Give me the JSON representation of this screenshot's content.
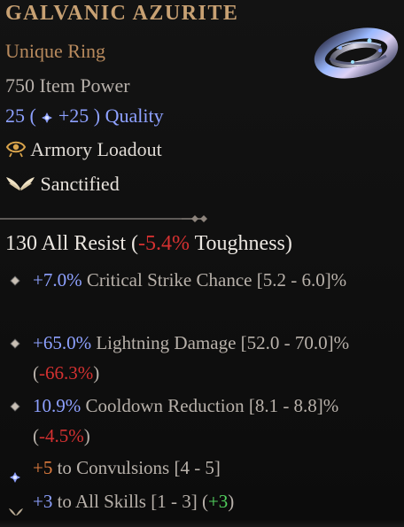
{
  "header": {
    "item_name": "GALVANIC AZURITE",
    "item_type": "Unique Ring",
    "item_power": "750 Item Power",
    "quality_prefix": "25 (",
    "quality_value": "+25",
    "quality_suffix": ") Quality",
    "armory_loadout": "Armory Loadout",
    "sanctified": "Sanctified"
  },
  "stats": {
    "resist_main": "130 All Resist (",
    "resist_toughness": "-5.4%",
    "resist_suffix": " Toughness)",
    "affixes": [
      {
        "prefix_value": "+7.0%",
        "text": " Critical Strike Chance [5.2 - 6.0]%",
        "value_color": "blue"
      },
      {
        "prefix_value": "+65.0%",
        "text": " Lightning Damage [52.0 - 70.0]% (",
        "extra": "-66.3%",
        "extra_suffix": ")",
        "value_color": "blue"
      },
      {
        "prefix_value": "10.9%",
        "text": " Cooldown Reduction [8.1 - 8.8]% (",
        "extra": "-4.5%",
        "extra_suffix": ")",
        "value_color": "blue"
      },
      {
        "prefix_value": "+5",
        "text": " to Convulsions [4 - 5]",
        "value_color": "orange"
      },
      {
        "prefix_value": "+3",
        "text": " to All Skills [1 - 3] (",
        "extra": "+3",
        "extra_suffix": ")",
        "value_color": "blue"
      }
    ]
  },
  "icons": {
    "quality_icon": "quality-gem-icon",
    "loadout_icon": "eye-icon",
    "sanct_icon": "wings-icon",
    "item_icon": "ring-icon"
  },
  "colors": {
    "title": "#c8a173",
    "unique": "#b88a5d",
    "quality": "#8ea1ff",
    "negative": "#d43131",
    "positive": "#52d15e"
  }
}
